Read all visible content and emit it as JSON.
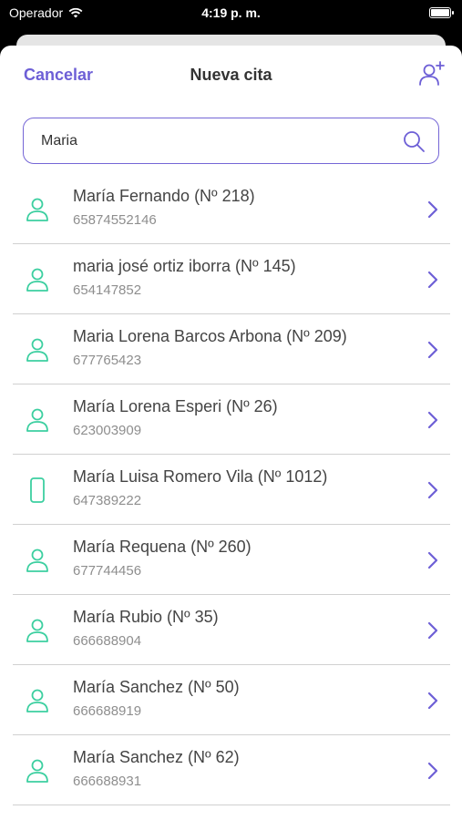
{
  "status_bar": {
    "carrier": "Operador",
    "time": "4:19 p. m."
  },
  "nav": {
    "cancel_label": "Cancelar",
    "title": "Nueva cita",
    "add_icon": "add-person-icon"
  },
  "search": {
    "value": "Maria",
    "icon": "search-icon"
  },
  "colors": {
    "accent": "#6d5fd6",
    "contact_icon": "#3ccfa0"
  },
  "contacts": [
    {
      "name": "María Fernando (Nº 218)",
      "phone": "65874552146",
      "icon": "person-icon"
    },
    {
      "name": "maria josé ortiz iborra (Nº 145)",
      "phone": "654147852",
      "icon": "person-icon"
    },
    {
      "name": "Maria Lorena Barcos Arbona (Nº 209)",
      "phone": "677765423",
      "icon": "person-icon"
    },
    {
      "name": "María Lorena Esperi (Nº 26)",
      "phone": "623003909",
      "icon": "person-icon"
    },
    {
      "name": "María Luisa Romero Vila (Nº 1012)",
      "phone": "647389222",
      "icon": "phone-icon"
    },
    {
      "name": "María Requena (Nº 260)",
      "phone": "677744456",
      "icon": "person-icon"
    },
    {
      "name": "María Rubio (Nº 35)",
      "phone": "666688904",
      "icon": "person-icon"
    },
    {
      "name": "María Sanchez (Nº 50)",
      "phone": "666688919",
      "icon": "person-icon"
    },
    {
      "name": "María Sanchez (Nº 62)",
      "phone": "666688931",
      "icon": "person-icon"
    }
  ]
}
